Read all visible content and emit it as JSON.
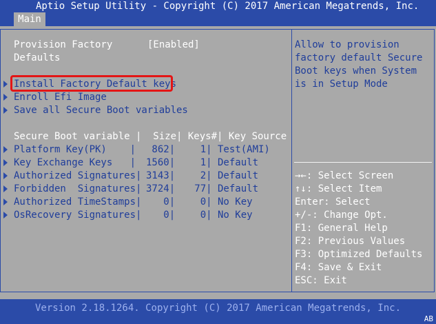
{
  "header": {
    "title": "Aptio Setup Utility - Copyright (C) 2017 American Megatrends, Inc.",
    "tab": "Main"
  },
  "settings": {
    "provision_label_1": "Provision Factory",
    "provision_label_2": "Defaults",
    "provision_value": "[Enabled]",
    "actions": [
      "Install Factory Default keys",
      "Enroll Efi Image",
      "Save all Secure Boot variables"
    ]
  },
  "table": {
    "header": "Secure Boot variable |  Size| Keys#| Key Source",
    "rows": [
      {
        "name": "Platform Key(PK)    |",
        "size": " 862|",
        "keys": "    1|",
        "source": "Test(AMI)"
      },
      {
        "name": "Key Exchange Keys   |",
        "size": "1560|",
        "keys": "    1|",
        "source": "Default"
      },
      {
        "name": "Authorized Signatures|",
        "size": "3143|",
        "keys": "    2|",
        "source": "Default"
      },
      {
        "name": "Forbidden  Signatures|",
        "size": "3724|",
        "keys": "   77|",
        "source": "Default"
      },
      {
        "name": "Authorized TimeStamps|",
        "size": "   0|",
        "keys": "    0|",
        "source": "No Key"
      },
      {
        "name": "OsRecovery Signatures|",
        "size": "   0|",
        "keys": "    0|",
        "source": "No Key"
      }
    ]
  },
  "help": {
    "lines": [
      "Allow to provision",
      "factory default Secure",
      "Boot keys when System",
      "is in Setup Mode"
    ]
  },
  "keys_help": [
    "→←: Select Screen",
    "↑↓: Select Item",
    "Enter: Select",
    "+/-: Change Opt.",
    "F1: General Help",
    "F2: Previous Values",
    "F3: Optimized Defaults",
    "F4: Save & Exit",
    "ESC: Exit"
  ],
  "footer": {
    "version": "Version 2.18.1264. Copyright (C) 2017 American Megatrends, Inc.",
    "corner": "AB"
  },
  "colors": {
    "background": "#a9a9a9",
    "bar": "#2b4ba8",
    "highlight": "#e41515"
  }
}
